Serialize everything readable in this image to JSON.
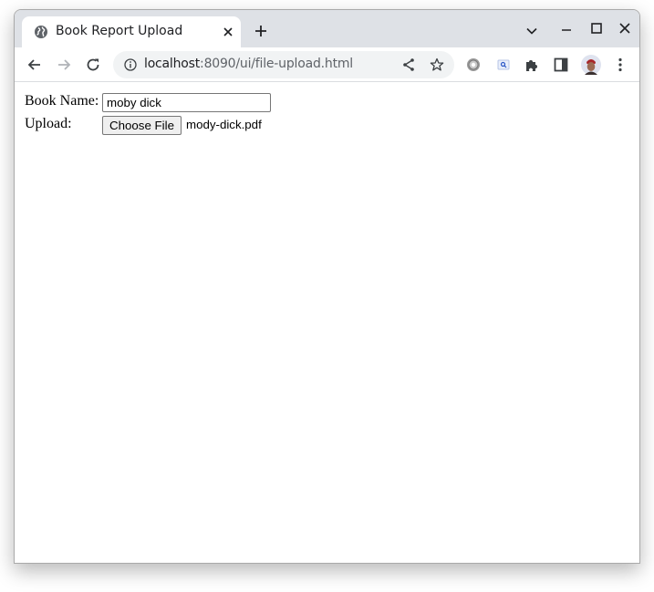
{
  "browser": {
    "tab": {
      "title": "Book Report Upload",
      "favicon": "globe-icon"
    },
    "address_bar": {
      "host": "localhost",
      "rest": ":8090/ui/file-upload.html"
    },
    "toolbar_icons": [
      "back-icon",
      "forward-icon",
      "reload-icon",
      "info-icon",
      "share-icon",
      "star-icon",
      "settings-extension-icon",
      "search-extension-icon",
      "extensions-puzzle-icon",
      "side-panel-icon",
      "profile-avatar",
      "menu-kebab-icon"
    ],
    "window_controls": [
      "tab-search-icon",
      "minimize-icon",
      "maximize-icon",
      "close-icon"
    ]
  },
  "form": {
    "book_name": {
      "label": "Book Name:",
      "value": "moby dick"
    },
    "upload": {
      "label": "Upload:",
      "button_label": "Choose File",
      "file_name": "mody-dick.pdf"
    }
  },
  "colors": {
    "tabstrip_bg": "#dee1e6",
    "omnibox_bg": "#f1f3f4",
    "text_primary": "#202124",
    "text_secondary": "#5f6368",
    "icon_color": "#5f6368"
  }
}
